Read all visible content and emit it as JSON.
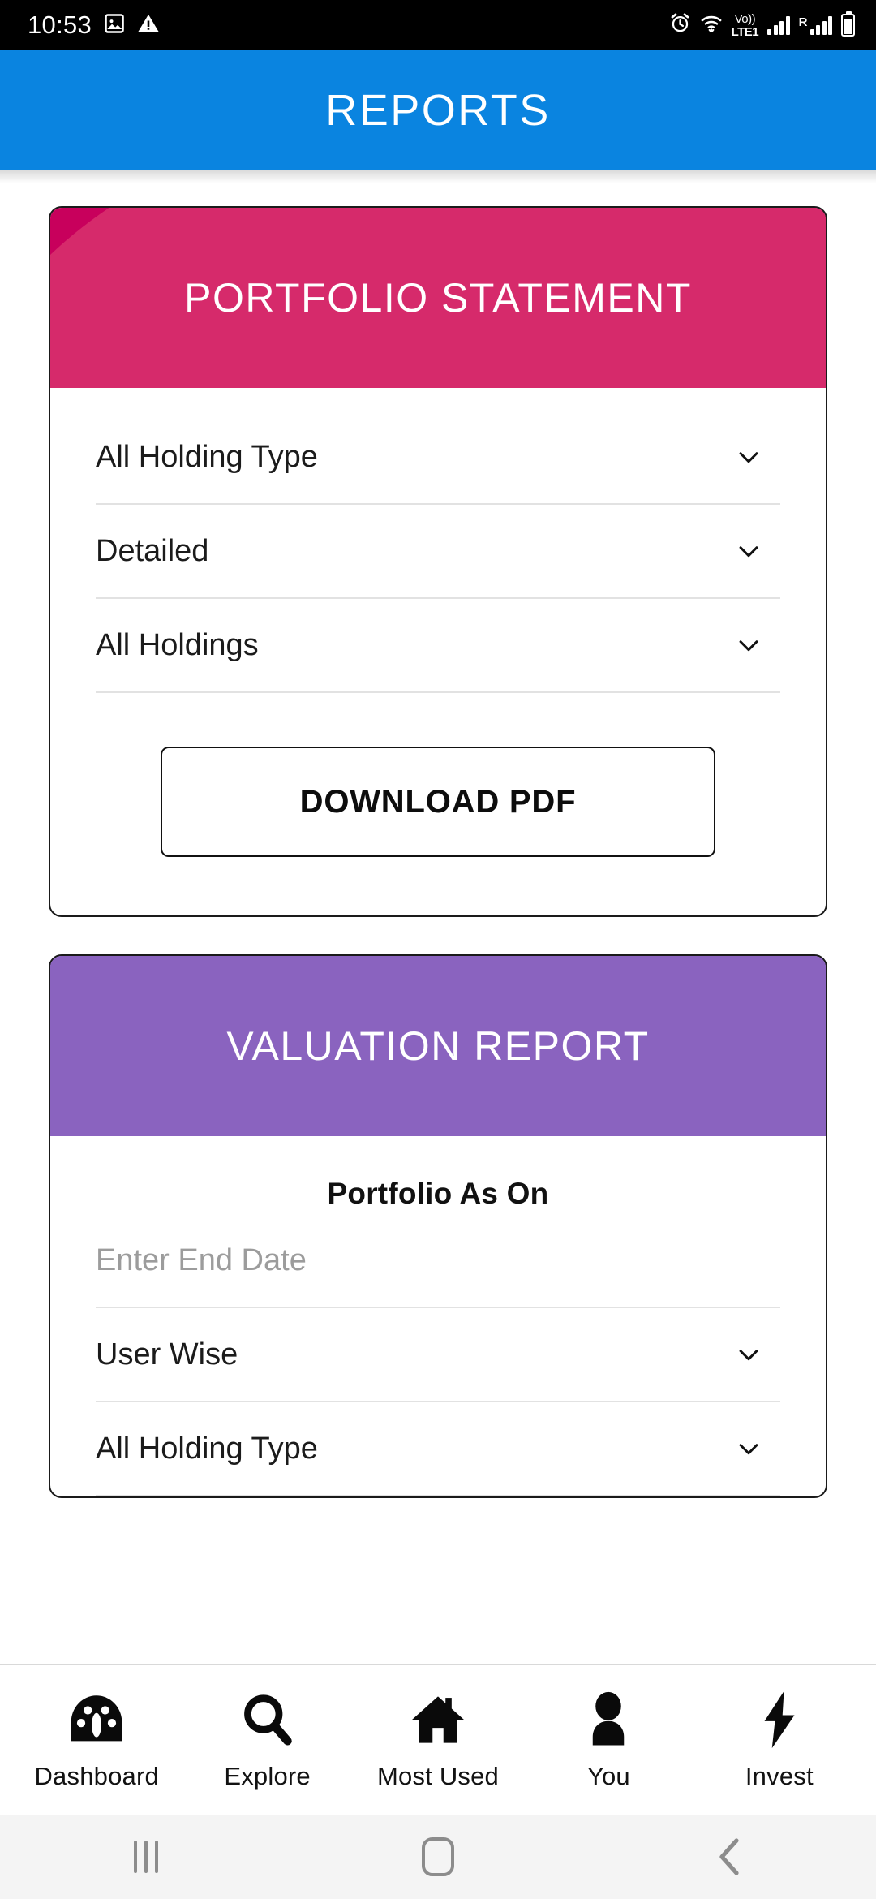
{
  "status_bar": {
    "time": "10:53",
    "left_icons": [
      "image-icon",
      "warning-triangle-icon"
    ],
    "right_icons": [
      "alarm-icon",
      "wifi-icon",
      "volte-icon",
      "signal-icon",
      "roaming-signal-icon",
      "battery-icon"
    ],
    "volte_top": "Vo))",
    "volte_bottom": "LTE1",
    "roaming_letter": "R"
  },
  "app_bar": {
    "title": "REPORTS"
  },
  "portfolio_statement": {
    "header_title": "PORTFOLIO STATEMENT",
    "header_color": "#c8005c",
    "header_accent_color": "#d62a6b",
    "fields": [
      {
        "value": "All Holding Type",
        "icon": "chevron-down-icon"
      },
      {
        "value": "Detailed",
        "icon": "chevron-down-icon"
      },
      {
        "value": "All Holdings",
        "icon": "chevron-down-icon"
      }
    ],
    "download_button": "DOWNLOAD PDF"
  },
  "valuation_report": {
    "header_title": "VALUATION REPORT",
    "header_color": "#7b4fb5",
    "header_accent_color": "#8a63bf",
    "section_label": "Portfolio As On",
    "date_placeholder": "Enter End Date",
    "date_value": "",
    "fields": [
      {
        "value": "User Wise",
        "icon": "chevron-down-icon"
      },
      {
        "value": "All Holding Type",
        "icon": "chevron-down-icon"
      }
    ]
  },
  "bottom_nav": {
    "items": [
      {
        "label": "Dashboard",
        "icon": "dashboard-gauge-icon"
      },
      {
        "label": "Explore",
        "icon": "search-icon"
      },
      {
        "label": "Most Used",
        "icon": "home-icon"
      },
      {
        "label": "You",
        "icon": "person-icon"
      },
      {
        "label": "Invest",
        "icon": "lightning-bolt-icon"
      }
    ]
  },
  "system_nav": {
    "recents": "recents-icon",
    "home": "home-circle-icon",
    "back": "back-chevron-icon"
  }
}
